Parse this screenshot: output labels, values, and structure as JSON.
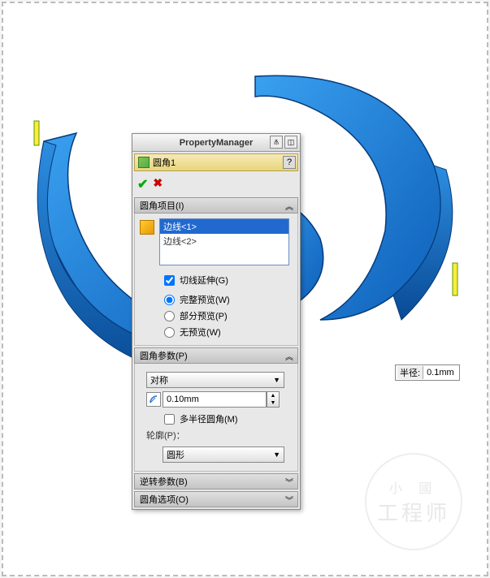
{
  "titlebar": {
    "title": "PropertyManager"
  },
  "feature": {
    "name": "圆角1",
    "help": "?"
  },
  "sections": {
    "items": {
      "title": "圆角项目(I)",
      "toggle": "︽",
      "edges": [
        "边线<1>",
        "边线<2>"
      ],
      "tangent": "切线延伸(G)",
      "preview": {
        "full": "完整预览(W)",
        "partial": "部分预览(P)",
        "none": "无预览(W)"
      }
    },
    "params": {
      "title": "圆角参数(P)",
      "toggle": "︽",
      "sym": "对称",
      "radius": "0.10mm",
      "multi": "多半径圆角(M)",
      "profile_lbl": "轮廓(P)：",
      "profile": "圆形"
    },
    "reverse": {
      "title": "逆转参数(B)",
      "toggle": "︾"
    },
    "options": {
      "title": "圆角选项(O)",
      "toggle": "︾"
    }
  },
  "callout": {
    "label": "半径:",
    "value": "0.1mm"
  },
  "watermark": {
    "l1": "小 國",
    "l2": "工程师"
  }
}
